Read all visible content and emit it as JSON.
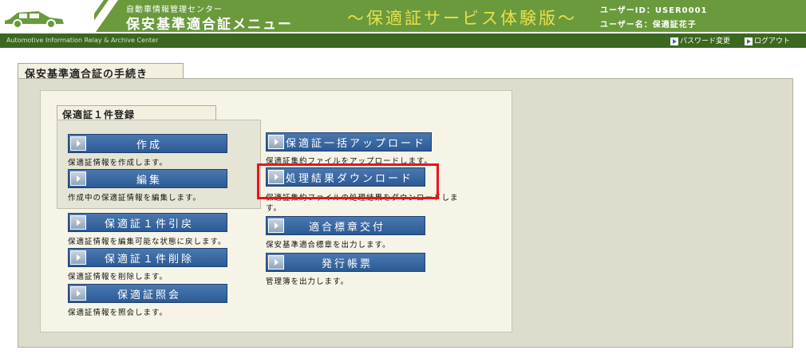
{
  "header": {
    "org_name": "自動車情報管理センター",
    "app_name": "保安基準適合証メニュー",
    "service_title": "〜保適証サービス体験版〜",
    "user_id": "ユーザーID：USER0001",
    "user_name": "ユーザー名：保適証花子",
    "subbar_text": "Automotive Information Relay & Archive Center",
    "password_change": "パスワード変更",
    "logout": "ログアウト",
    "colors": {
      "header_bg": "#6a9a3c",
      "subbar_bg": "#3a6820",
      "title_yellow": "#e9e04a"
    }
  },
  "main": {
    "section_title": "保安基準適合証の手続き",
    "sub_section_title": "保適証１件登録",
    "buttons": {
      "create": {
        "label": "作成",
        "desc": "保適証情報を作成します。"
      },
      "edit": {
        "label": "編集",
        "desc": "作成中の保適証情報を編集します。"
      },
      "revert": {
        "label": "保適証１件引戻",
        "desc": "保適証情報を編集可能な状態に戻します。"
      },
      "delete": {
        "label": "保適証１件削除",
        "desc": "保適証情報を削除します。"
      },
      "inquiry": {
        "label": "保適証照会",
        "desc": "保適証情報を照会します。"
      },
      "bulk_upload": {
        "label": "保適証一括アップロード",
        "desc": "保適証集約ファイルをアップロードします。"
      },
      "result_download": {
        "label": "処理結果ダウンロード",
        "desc_line1": "保適証集約ファイルの処理結果をダウンロードしま",
        "desc_line2": "す。"
      },
      "badge_issue": {
        "label": "適合標章交付",
        "desc": "保安基準適合標章を出力します。"
      },
      "issue_ledger": {
        "label": "発行帳票",
        "desc": "管理簿を出力します。"
      }
    },
    "colors": {
      "button_blue": "#2c5a94",
      "highlight_red": "#e8141c",
      "panel_bg": "#dedccc"
    }
  }
}
